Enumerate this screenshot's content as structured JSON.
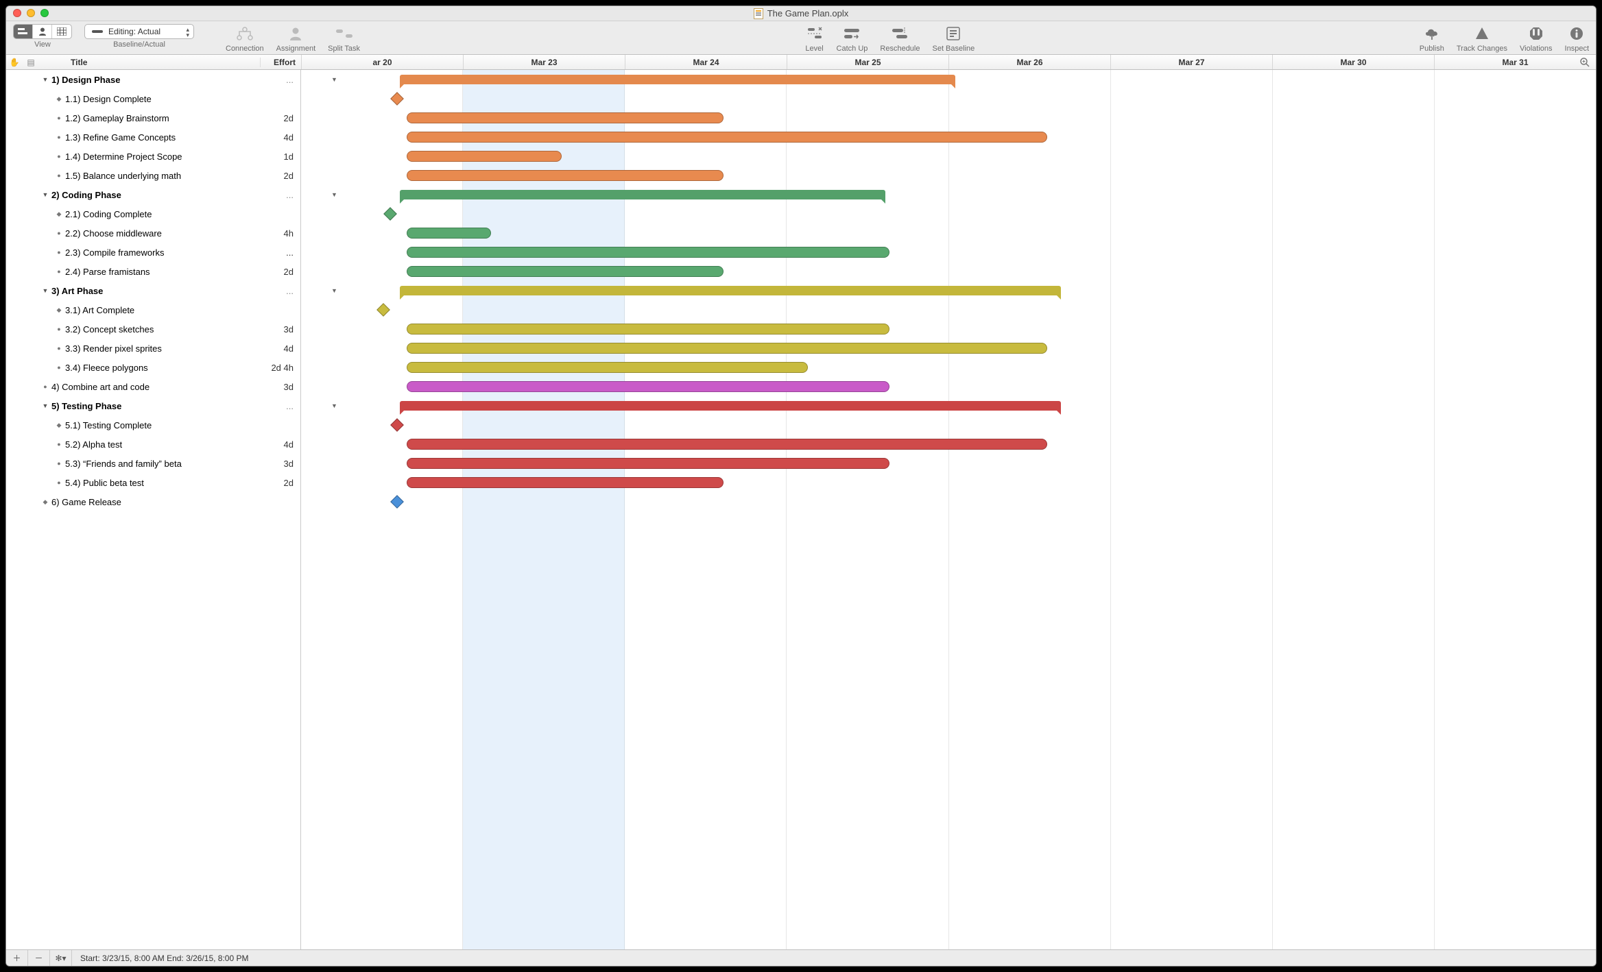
{
  "window_title": "The Game Plan.oplx",
  "toolbar": {
    "view_label": "View",
    "baseline_label": "Baseline/Actual",
    "editing_label": "Editing: Actual",
    "buttons": {
      "connection": "Connection",
      "assignment": "Assignment",
      "split_task": "Split Task",
      "level": "Level",
      "catch_up": "Catch Up",
      "reschedule": "Reschedule",
      "set_baseline": "Set Baseline",
      "publish": "Publish",
      "track_changes": "Track Changes",
      "violations": "Violations",
      "inspect": "Inspect"
    }
  },
  "columns": {
    "title": "Title",
    "effort": "Effort"
  },
  "timeline_days": [
    "ar 20",
    "Mar 23",
    "Mar 24",
    "Mar 25",
    "Mar 26",
    "Mar 27",
    "Mar 30",
    "Mar 31"
  ],
  "tasks": [
    {
      "id": "1",
      "num": "1)",
      "title": "Design Phase",
      "effort": "...",
      "type": "summary",
      "level": 0,
      "color": "orange",
      "start": 70,
      "end": 465
    },
    {
      "id": "1.1",
      "num": "1.1)",
      "title": "Design Complete",
      "effort": "",
      "type": "milestone",
      "level": 1,
      "color": "orange",
      "start": 65
    },
    {
      "id": "1.2",
      "num": "1.2)",
      "title": "Gameplay Brainstorm",
      "effort": "2d",
      "type": "task",
      "level": 1,
      "color": "orange",
      "start": 75,
      "end": 300
    },
    {
      "id": "1.3",
      "num": "1.3)",
      "title": "Refine Game Concepts",
      "effort": "4d",
      "type": "task",
      "level": 1,
      "color": "orange",
      "start": 75,
      "end": 530
    },
    {
      "id": "1.4",
      "num": "1.4)",
      "title": "Determine Project Scope",
      "effort": "1d",
      "type": "task",
      "level": 1,
      "color": "orange",
      "start": 75,
      "end": 185
    },
    {
      "id": "1.5",
      "num": "1.5)",
      "title": "Balance underlying math",
      "effort": "2d",
      "type": "task",
      "level": 1,
      "color": "orange",
      "start": 75,
      "end": 300
    },
    {
      "id": "2",
      "num": "2)",
      "title": "Coding Phase",
      "effort": "...",
      "type": "summary",
      "level": 0,
      "color": "green",
      "start": 70,
      "end": 415
    },
    {
      "id": "2.1",
      "num": "2.1)",
      "title": "Coding Complete",
      "effort": "",
      "type": "milestone",
      "level": 1,
      "color": "green",
      "start": 60
    },
    {
      "id": "2.2",
      "num": "2.2)",
      "title": "Choose middleware",
      "effort": "4h",
      "type": "task",
      "level": 1,
      "color": "green",
      "start": 75,
      "end": 135
    },
    {
      "id": "2.3",
      "num": "2.3)",
      "title": "Compile frameworks",
      "effort": "...",
      "type": "task",
      "level": 1,
      "color": "green",
      "start": 75,
      "end": 418
    },
    {
      "id": "2.4",
      "num": "2.4)",
      "title": "Parse framistans",
      "effort": "2d",
      "type": "task",
      "level": 1,
      "color": "green",
      "start": 75,
      "end": 300
    },
    {
      "id": "3",
      "num": "3)",
      "title": "Art Phase",
      "effort": "...",
      "type": "summary",
      "level": 0,
      "color": "yellow",
      "start": 70,
      "end": 540
    },
    {
      "id": "3.1",
      "num": "3.1)",
      "title": "Art Complete",
      "effort": "",
      "type": "milestone",
      "level": 1,
      "color": "yellow",
      "start": 55
    },
    {
      "id": "3.2",
      "num": "3.2)",
      "title": "Concept sketches",
      "effort": "3d",
      "type": "task",
      "level": 1,
      "color": "yellow",
      "start": 75,
      "end": 418
    },
    {
      "id": "3.3",
      "num": "3.3)",
      "title": "Render pixel sprites",
      "effort": "4d",
      "type": "task",
      "level": 1,
      "color": "yellow",
      "start": 75,
      "end": 530
    },
    {
      "id": "3.4",
      "num": "3.4)",
      "title": "Fleece polygons",
      "effort": "2d 4h",
      "type": "task",
      "level": 1,
      "color": "yellow",
      "start": 75,
      "end": 360
    },
    {
      "id": "4",
      "num": "4)",
      "title": "Combine art and code",
      "effort": "3d",
      "type": "task",
      "level": 0,
      "color": "purple",
      "start": 75,
      "end": 418
    },
    {
      "id": "5",
      "num": "5)",
      "title": "Testing Phase",
      "effort": "...",
      "type": "summary",
      "level": 0,
      "color": "red",
      "start": 70,
      "end": 540
    },
    {
      "id": "5.1",
      "num": "5.1)",
      "title": "Testing Complete",
      "effort": "",
      "type": "milestone",
      "level": 1,
      "color": "red",
      "start": 65
    },
    {
      "id": "5.2",
      "num": "5.2)",
      "title": "Alpha test",
      "effort": "4d",
      "type": "task",
      "level": 1,
      "color": "red",
      "start": 75,
      "end": 530
    },
    {
      "id": "5.3",
      "num": "5.3)",
      "title": "“Friends and family” beta",
      "effort": "3d",
      "type": "task",
      "level": 1,
      "color": "red",
      "start": 75,
      "end": 418
    },
    {
      "id": "5.4",
      "num": "5.4)",
      "title": "Public beta test",
      "effort": "2d",
      "type": "task",
      "level": 1,
      "color": "red",
      "start": 75,
      "end": 300
    },
    {
      "id": "6",
      "num": "6)",
      "title": "Game Release",
      "effort": "",
      "type": "milestone",
      "level": 0,
      "color": "blue",
      "start": 65
    }
  ],
  "footer": {
    "status": "Start: 3/23/15, 8:00 AM End: 3/26/15, 8:00 PM"
  }
}
